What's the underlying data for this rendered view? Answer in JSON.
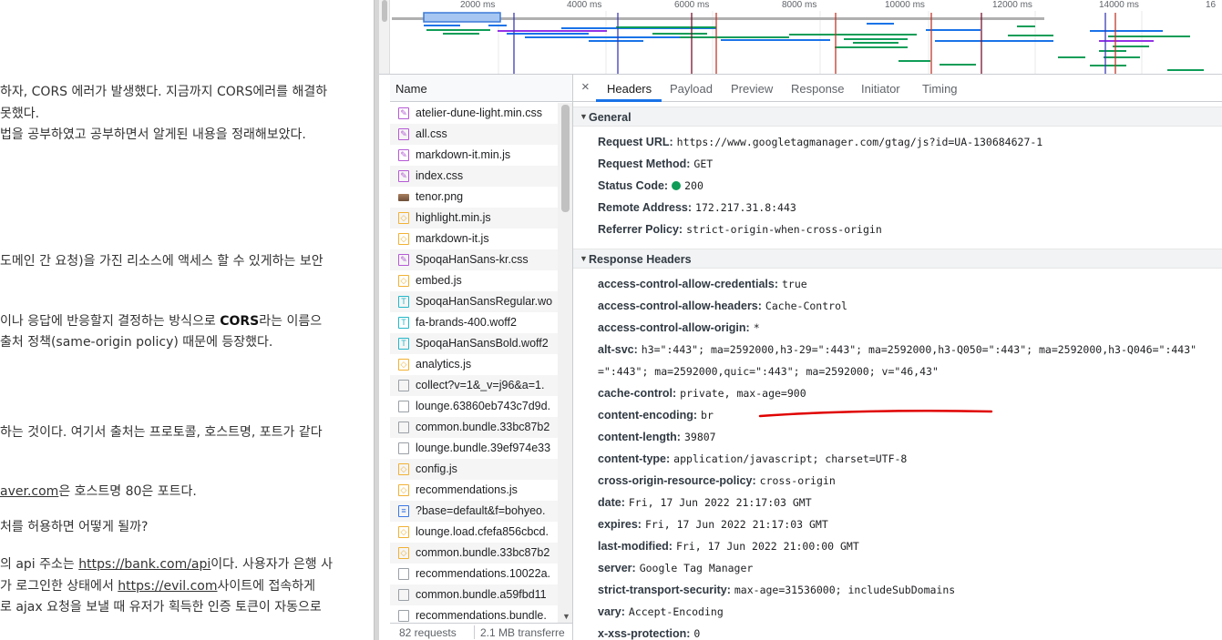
{
  "article": {
    "lines": [
      {
        "text": "하자, CORS 에러가 발생했다. 지금까지 CORS에러를 해결하"
      },
      {
        "text": " 못했다."
      },
      {
        "text": "법을 공부하였고 공부하면서 알게된 내용을 정래해보았다."
      },
      {
        "text": "도메인 간 요청)을 가진 리소스에 액세스 할 수 있게하는 보안"
      },
      {
        "pre": "이나 응답에 반응할지 결정하는 방식으로 ",
        "bold": "CORS",
        "post": "라는 이름으"
      },
      {
        "text": "출처 정책(same-origin policy) 때문에 등장했다."
      },
      {
        "text": "하는 것이다. 여기서 출처는 프로토콜, 호스트명, 포트가 같다"
      },
      {
        "link": "aver.com",
        "post": "은 호스트명 80은 포트다."
      },
      {
        "text": "처를 허용하면 어떻게 될까?"
      },
      {
        "pre": "의 api 주소는 ",
        "link": "https://bank.com/api",
        "post": "이다. 사용자가 은행 사"
      },
      {
        "pre": "가 로그인한 상태에서 ",
        "link": "https://evil.com",
        "post": "사이트에 접속하게"
      },
      {
        "text": "로 ajax 요청을 보낼 때 유저가 획득한 인증 토큰이 자동으로"
      }
    ]
  },
  "timeline": {
    "ticks": [
      "2000 ms",
      "4000 ms",
      "6000 ms",
      "8000 ms",
      "10000 ms",
      "12000 ms",
      "14000 ms",
      "16"
    ]
  },
  "requests": {
    "column_header": "Name",
    "items": [
      {
        "name": "atelier-dune-light.min.css",
        "icon": "css-file-icon"
      },
      {
        "name": "all.css",
        "icon": "css-file-icon"
      },
      {
        "name": "markdown-it.min.js",
        "icon": "css-file-icon"
      },
      {
        "name": "index.css",
        "icon": "css-file-icon"
      },
      {
        "name": "tenor.png",
        "icon": "image-file-icon"
      },
      {
        "name": "highlight.min.js",
        "icon": "js-file-icon"
      },
      {
        "name": "markdown-it.js",
        "icon": "js-file-icon"
      },
      {
        "name": "SpoqaHanSans-kr.css",
        "icon": "css-file-icon"
      },
      {
        "name": "embed.js",
        "icon": "js-file-icon"
      },
      {
        "name": "SpoqaHanSansRegular.wo",
        "icon": "font-file-icon"
      },
      {
        "name": "fa-brands-400.woff2",
        "icon": "font-file-icon"
      },
      {
        "name": "SpoqaHanSansBold.woff2",
        "icon": "font-file-icon"
      },
      {
        "name": "analytics.js",
        "icon": "js-file-icon"
      },
      {
        "name": "collect?v=1&_v=j96&a=1.",
        "icon": "document-icon"
      },
      {
        "name": "lounge.63860eb743c7d9d.",
        "icon": "document-icon"
      },
      {
        "name": "common.bundle.33bc87b2",
        "icon": "document-icon"
      },
      {
        "name": "lounge.bundle.39ef974e33",
        "icon": "document-icon"
      },
      {
        "name": "config.js",
        "icon": "js-file-icon"
      },
      {
        "name": "recommendations.js",
        "icon": "js-file-icon"
      },
      {
        "name": "?base=default&f=bohyeo.",
        "icon": "script-file-icon"
      },
      {
        "name": "lounge.load.cfefa856cbcd.",
        "icon": "js-file-icon"
      },
      {
        "name": "common.bundle.33bc87b2",
        "icon": "js-file-icon"
      },
      {
        "name": "recommendations.10022a.",
        "icon": "document-icon"
      },
      {
        "name": "common.bundle.a59fbd11",
        "icon": "document-icon"
      },
      {
        "name": "recommendations.bundle.",
        "icon": "document-icon"
      }
    ],
    "status_count": "82 requests",
    "status_transfer": "2.1 MB transferre"
  },
  "details": {
    "close_label": "×",
    "tabs": [
      "Headers",
      "Payload",
      "Preview",
      "Response",
      "Initiator",
      "Timing"
    ],
    "active_tab": "Headers",
    "general": {
      "title": "General",
      "rows": [
        {
          "key": "Request URL:",
          "value": "https://www.googletagmanager.com/gtag/js?id=UA-130684627-1"
        },
        {
          "key": "Request Method:",
          "value": "GET"
        },
        {
          "key": "Status Code:",
          "value": "200"
        },
        {
          "key": "Remote Address:",
          "value": "172.217.31.8:443"
        },
        {
          "key": "Referrer Policy:",
          "value": "strict-origin-when-cross-origin"
        }
      ]
    },
    "response_headers": {
      "title": "Response Headers",
      "rows": [
        {
          "key": "access-control-allow-credentials:",
          "value": "true"
        },
        {
          "key": "access-control-allow-headers:",
          "value": "Cache-Control"
        },
        {
          "key": "access-control-allow-origin:",
          "value": "*"
        },
        {
          "key": "alt-svc:",
          "value": "h3=\":443\"; ma=2592000,h3-29=\":443\"; ma=2592000,h3-Q050=\":443\"; ma=2592000,h3-Q046=\":443\""
        },
        {
          "key": "",
          "value": "=\":443\"; ma=2592000,quic=\":443\"; ma=2592000; v=\"46,43\""
        },
        {
          "key": "cache-control:",
          "value": "private, max-age=900"
        },
        {
          "key": "content-encoding:",
          "value": "br"
        },
        {
          "key": "content-length:",
          "value": "39807"
        },
        {
          "key": "content-type:",
          "value": "application/javascript; charset=UTF-8"
        },
        {
          "key": "cross-origin-resource-policy:",
          "value": "cross-origin"
        },
        {
          "key": "date:",
          "value": "Fri, 17 Jun 2022 21:17:03 GMT"
        },
        {
          "key": "expires:",
          "value": "Fri, 17 Jun 2022 21:17:03 GMT"
        },
        {
          "key": "last-modified:",
          "value": "Fri, 17 Jun 2022 21:00:00 GMT"
        },
        {
          "key": "server:",
          "value": "Google Tag Manager"
        },
        {
          "key": "strict-transport-security:",
          "value": "max-age=31536000; includeSubDomains"
        },
        {
          "key": "vary:",
          "value": "Accept-Encoding"
        },
        {
          "key": "x-xss-protection:",
          "value": "0"
        }
      ]
    }
  },
  "colors": {
    "status_ok": "#0f9d58",
    "annotation_underline": "#e00000",
    "tab_accent": "#1a73e8"
  }
}
